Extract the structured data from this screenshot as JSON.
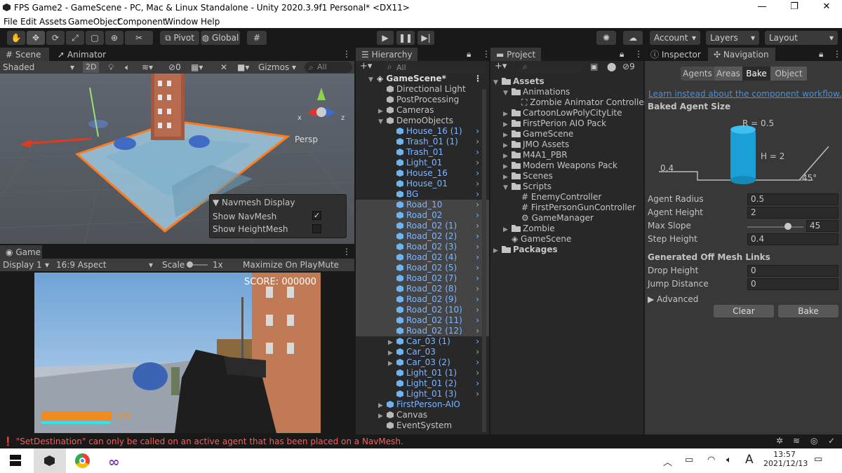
{
  "window": {
    "title": "FPS Game2 - GameScene - PC, Mac & Linux Standalone - Unity 2020.3.9f1 Personal* <DX11>",
    "minimize": "—",
    "maximize": "❐",
    "close": "✕"
  },
  "menu": [
    "File",
    "Edit",
    "Assets",
    "GameObject",
    "Component",
    "Window",
    "Help"
  ],
  "toolbar": {
    "pivot": "Pivot",
    "global": "Global",
    "account": "Account",
    "layers": "Layers",
    "layout": "Layout"
  },
  "scene": {
    "tab_scene": "Scene",
    "tab_animator": "Animator",
    "shading": "Shaded",
    "mode2d": "2D",
    "hidden_count": "0",
    "gizmos": "Gizmos",
    "search_placeholder": "All",
    "persp": "Persp",
    "axis_x": "x",
    "axis_z": "z",
    "navmesh_display": {
      "title": "Navmesh Display",
      "show_navmesh": "Show NavMesh",
      "show_heightmesh": "Show HeightMesh",
      "navmesh_checked": true,
      "heightmesh_checked": false
    }
  },
  "game": {
    "tab": "Game",
    "display": "Display 1",
    "aspect": "16:9 Aspect",
    "scale_label": "Scale",
    "scale_value": "1x",
    "maximize": "Maximize On Play",
    "mute": "Mute Aud",
    "score": "SCORE: 000000",
    "health": "100",
    "health_fill": 0.6
  },
  "hierarchy": {
    "tab": "Hierarchy",
    "search_placeholder": "All",
    "scene_name": "GameScene*",
    "items": [
      {
        "label": "Directional Light",
        "indent": 1,
        "type": "grey",
        "arrow": ""
      },
      {
        "label": "PostProcessing",
        "indent": 1,
        "type": "grey",
        "arrow": ""
      },
      {
        "label": "Cameras",
        "indent": 1,
        "type": "grey",
        "arrow": "▶"
      },
      {
        "label": "DemoObjects",
        "indent": 1,
        "type": "grey",
        "arrow": "▼"
      },
      {
        "label": "House_16 (1)",
        "indent": 2,
        "type": "blue",
        "arrow": ""
      },
      {
        "label": "Trash_01 (1)",
        "indent": 2,
        "type": "blue",
        "arrow": ""
      },
      {
        "label": "Trash_01",
        "indent": 2,
        "type": "blue",
        "arrow": ""
      },
      {
        "label": "Light_01",
        "indent": 2,
        "type": "blue",
        "arrow": ""
      },
      {
        "label": "House_16",
        "indent": 2,
        "type": "blue",
        "arrow": ""
      },
      {
        "label": "House_01",
        "indent": 2,
        "type": "blue",
        "arrow": ""
      },
      {
        "label": "BG",
        "indent": 2,
        "type": "blue",
        "arrow": ""
      },
      {
        "label": "Road_10",
        "indent": 2,
        "type": "sel",
        "arrow": ""
      },
      {
        "label": "Road_02",
        "indent": 2,
        "type": "sel",
        "arrow": ""
      },
      {
        "label": "Road_02 (1)",
        "indent": 2,
        "type": "sel",
        "arrow": ""
      },
      {
        "label": "Road_02 (2)",
        "indent": 2,
        "type": "sel",
        "arrow": ""
      },
      {
        "label": "Road_02 (3)",
        "indent": 2,
        "type": "sel",
        "arrow": ""
      },
      {
        "label": "Road_02 (4)",
        "indent": 2,
        "type": "sel",
        "arrow": ""
      },
      {
        "label": "Road_02 (5)",
        "indent": 2,
        "type": "sel",
        "arrow": ""
      },
      {
        "label": "Road_02 (7)",
        "indent": 2,
        "type": "sel",
        "arrow": ""
      },
      {
        "label": "Road_02 (8)",
        "indent": 2,
        "type": "sel",
        "arrow": ""
      },
      {
        "label": "Road_02 (9)",
        "indent": 2,
        "type": "sel",
        "arrow": ""
      },
      {
        "label": "Road_02 (10)",
        "indent": 2,
        "type": "sel",
        "arrow": ""
      },
      {
        "label": "Road_02 (11)",
        "indent": 2,
        "type": "sel",
        "arrow": ""
      },
      {
        "label": "Road_02 (12)",
        "indent": 2,
        "type": "sel",
        "arrow": ""
      },
      {
        "label": "Car_03 (1)",
        "indent": 2,
        "type": "blue",
        "arrow": "▶"
      },
      {
        "label": "Car_03",
        "indent": 2,
        "type": "blue",
        "arrow": "▶"
      },
      {
        "label": "Car_03 (2)",
        "indent": 2,
        "type": "blue",
        "arrow": "▶"
      },
      {
        "label": "Light_01 (1)",
        "indent": 2,
        "type": "blue",
        "arrow": ""
      },
      {
        "label": "Light_01 (2)",
        "indent": 2,
        "type": "blue",
        "arrow": ""
      },
      {
        "label": "Light_01 (3)",
        "indent": 2,
        "type": "blue",
        "arrow": ""
      },
      {
        "label": "FirstPerson-AIO",
        "indent": 1,
        "type": "blue",
        "arrow": "▶"
      },
      {
        "label": "Canvas",
        "indent": 1,
        "type": "grey",
        "arrow": "▶"
      },
      {
        "label": "EventSystem",
        "indent": 1,
        "type": "grey",
        "arrow": ""
      }
    ]
  },
  "project": {
    "tab": "Project",
    "hidden_count": "9",
    "items": [
      {
        "label": "Assets",
        "indent": 0,
        "kind": "folder",
        "arrow": "▼",
        "bold": true
      },
      {
        "label": "Animations",
        "indent": 1,
        "kind": "folder",
        "arrow": "▼"
      },
      {
        "label": "Zombie Animator Controller",
        "indent": 2,
        "kind": "anim",
        "arrow": ""
      },
      {
        "label": "CartoonLowPolyCityLite",
        "indent": 1,
        "kind": "folder",
        "arrow": "▶"
      },
      {
        "label": "FirstPerion AIO Pack",
        "indent": 1,
        "kind": "folder",
        "arrow": "▶"
      },
      {
        "label": "GameScene",
        "indent": 1,
        "kind": "folder",
        "arrow": "▶"
      },
      {
        "label": "JMO Assets",
        "indent": 1,
        "kind": "folder",
        "arrow": "▶"
      },
      {
        "label": "M4A1_PBR",
        "indent": 1,
        "kind": "folder",
        "arrow": "▶"
      },
      {
        "label": "Modern Weapons Pack",
        "indent": 1,
        "kind": "folder",
        "arrow": "▶"
      },
      {
        "label": "Scenes",
        "indent": 1,
        "kind": "folder",
        "arrow": "▶"
      },
      {
        "label": "Scripts",
        "indent": 1,
        "kind": "folder",
        "arrow": "▼"
      },
      {
        "label": "EnemyController",
        "indent": 2,
        "kind": "script",
        "arrow": ""
      },
      {
        "label": "FirstPersonGunController",
        "indent": 2,
        "kind": "script",
        "arrow": ""
      },
      {
        "label": "GameManager",
        "indent": 2,
        "kind": "gear",
        "arrow": ""
      },
      {
        "label": "Zombie",
        "indent": 1,
        "kind": "folder",
        "arrow": "▶"
      },
      {
        "label": "GameScene",
        "indent": 1,
        "kind": "unity",
        "arrow": ""
      },
      {
        "label": "Packages",
        "indent": 0,
        "kind": "folder",
        "arrow": "▶",
        "bold": true
      }
    ]
  },
  "navigation": {
    "tab_inspector": "Inspector",
    "tab_navigation": "Navigation",
    "subtabs": [
      "Agents",
      "Areas",
      "Bake",
      "Object"
    ],
    "active_subtab": "Bake",
    "link": "Learn instead about the component workflow.",
    "baked_agent_size": "Baked Agent Size",
    "diagram": {
      "r": "R = 0.5",
      "h": "H = 2",
      "step": "0.4",
      "slope": "45°"
    },
    "fields": [
      {
        "label": "Agent Radius",
        "value": "0.5"
      },
      {
        "label": "Agent Height",
        "value": "2"
      },
      {
        "label": "Max Slope",
        "value": "45",
        "slider": 0.75
      },
      {
        "label": "Step Height",
        "value": "0.4"
      }
    ],
    "offmesh_header": "Generated Off Mesh Links",
    "offmesh": [
      {
        "label": "Drop Height",
        "value": "0"
      },
      {
        "label": "Jump Distance",
        "value": "0"
      }
    ],
    "advanced": "Advanced",
    "clear": "Clear",
    "bake": "Bake"
  },
  "status": {
    "message": "\"SetDestination\" can only be called on an active agent that has been placed on a NavMesh."
  },
  "taskbar": {
    "time": "13:57",
    "date": "2021/12/13",
    "ime": "A"
  },
  "colors": {
    "accent": "#4a90d9",
    "error": "#ff5b5b",
    "health": "#f08c1e",
    "cyan": "#2ee6e6"
  }
}
